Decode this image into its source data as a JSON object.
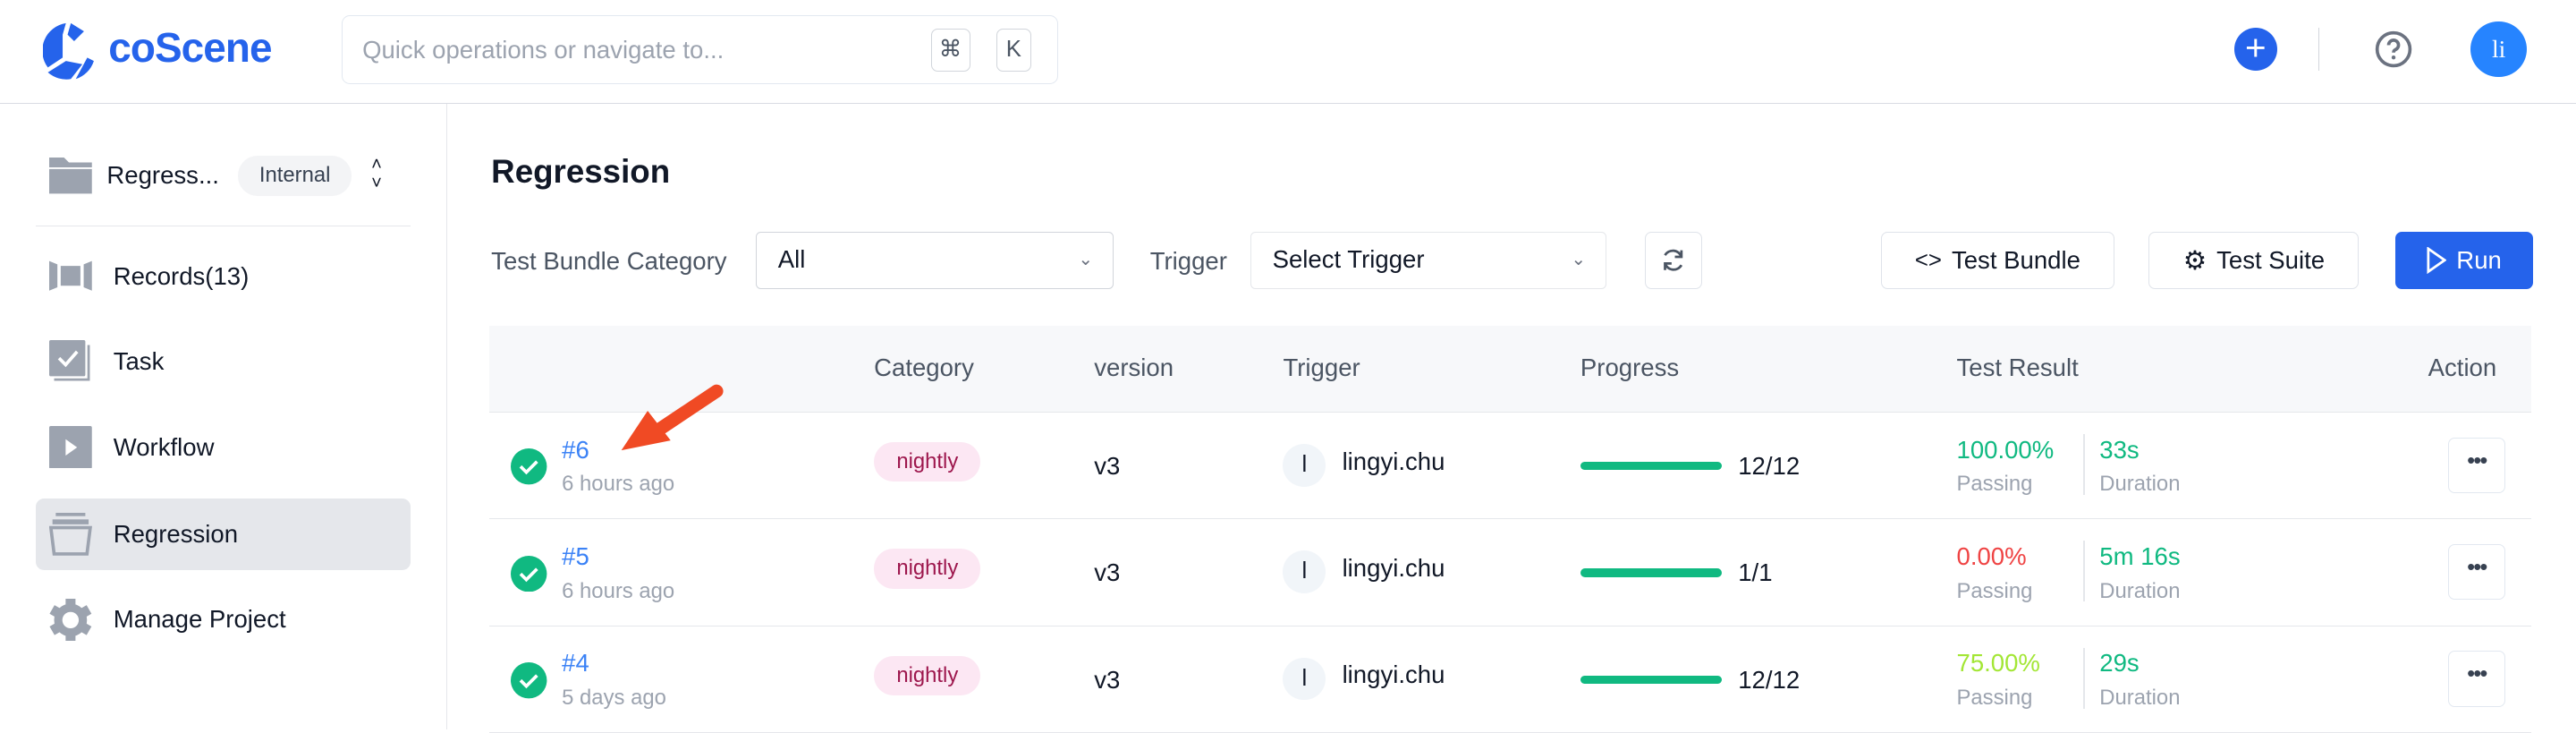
{
  "header": {
    "logo": "coScene",
    "search_placeholder": "Quick operations or navigate to...",
    "shortcut_keys": [
      "⌘",
      "K"
    ],
    "avatar_initials": "li",
    "brand_color": "#2563eb"
  },
  "sidebar": {
    "project_name": "Regress...",
    "project_visibility": "Internal",
    "items": [
      {
        "label": "Records(13)",
        "icon": "records-icon"
      },
      {
        "label": "Task",
        "icon": "task-icon"
      },
      {
        "label": "Workflow",
        "icon": "workflow-icon"
      },
      {
        "label": "Regression",
        "icon": "regression-icon",
        "active": true
      },
      {
        "label": "Manage Project",
        "icon": "gear-icon"
      }
    ]
  },
  "main": {
    "title": "Regression",
    "filters": {
      "category_label": "Test Bundle Category",
      "category_value": "All",
      "trigger_label": "Trigger",
      "trigger_placeholder": "Select Trigger"
    },
    "buttons": {
      "test_bundle": "Test Bundle",
      "test_suite": "Test Suite",
      "run": "Run"
    },
    "table": {
      "headers": [
        "",
        "Category",
        "version",
        "Trigger",
        "Progress",
        "Test Result",
        "Action"
      ],
      "passing_label": "Passing",
      "duration_label": "Duration",
      "rows": [
        {
          "id": "#6",
          "time": "6 hours ago",
          "category": "nightly",
          "version": "v3",
          "trigger_initial": "l",
          "trigger": "lingyi.chu",
          "progress": "12/12",
          "progress_fraction": 1.0,
          "pass_rate": "100.00%",
          "pass_color": "#10b981",
          "duration": "33s"
        },
        {
          "id": "#5",
          "time": "6 hours ago",
          "category": "nightly",
          "version": "v3",
          "trigger_initial": "l",
          "trigger": "lingyi.chu",
          "progress": "1/1",
          "progress_fraction": 1.0,
          "pass_rate": "0.00%",
          "pass_color": "#ef4444",
          "duration": "5m 16s"
        },
        {
          "id": "#4",
          "time": "5 days ago",
          "category": "nightly",
          "version": "v3",
          "trigger_initial": "l",
          "trigger": "lingyi.chu",
          "progress": "12/12",
          "progress_fraction": 1.0,
          "pass_rate": "75.00%",
          "pass_color": "#a3e635",
          "duration": "29s"
        }
      ]
    }
  }
}
